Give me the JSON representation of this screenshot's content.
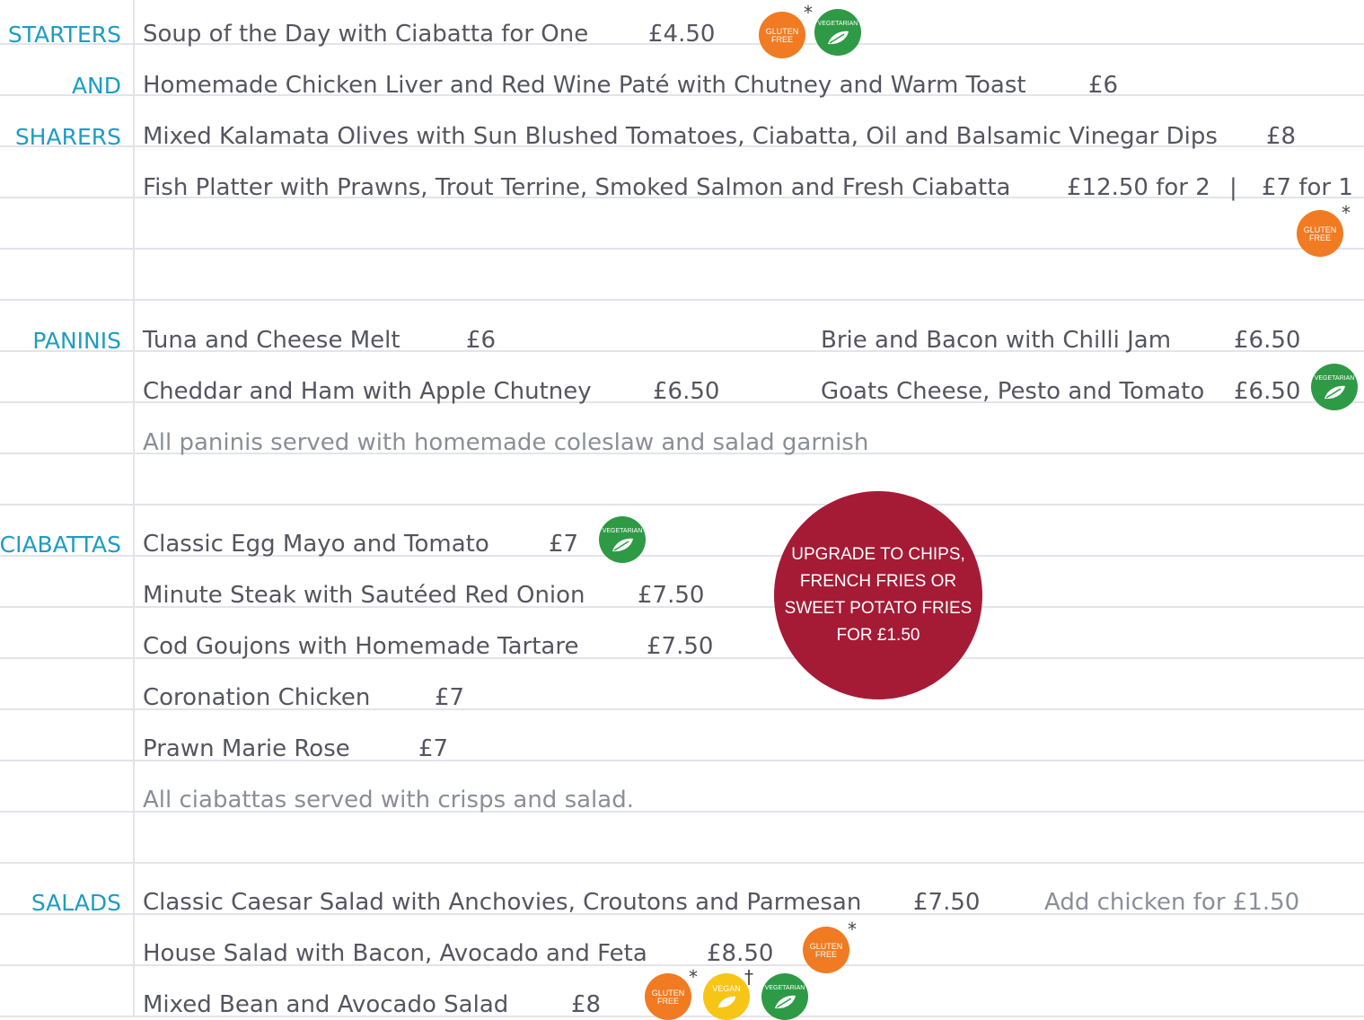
{
  "sections": {
    "starters_1": "STARTERS",
    "starters_2": "AND",
    "starters_3": "SHARERS",
    "paninis": "PANINIS",
    "ciabattas": "CIABATTAS",
    "salads": "SALADS"
  },
  "starters": [
    {
      "name": "Soup of the Day with Ciabatta for One",
      "price": "£4.50"
    },
    {
      "name": "Homemade Chicken Liver and Red Wine Paté with Chutney and Warm Toast",
      "price": "£6"
    },
    {
      "name": "Mixed Kalamata Olives with Sun Blushed Tomatoes, Ciabatta, Oil and Balsamic Vinegar Dips",
      "price": "£8"
    },
    {
      "name": "Fish Platter with Prawns, Trout Terrine, Smoked Salmon and Fresh Ciabatta",
      "price": "£12.50 for 2",
      "separator": "|",
      "price_alt": "£7 for 1"
    }
  ],
  "paninis": [
    {
      "name": "Tuna and Cheese Melt",
      "price": "£6"
    },
    {
      "name": "Cheddar and Ham with Apple Chutney",
      "price": "£6.50"
    },
    {
      "name": "Brie and Bacon with Chilli Jam",
      "price": "£6.50"
    },
    {
      "name": "Goats Cheese, Pesto and Tomato",
      "price": "£6.50"
    }
  ],
  "paninis_note": "All paninis served with homemade coleslaw and salad garnish",
  "ciabattas": [
    {
      "name": "Classic Egg Mayo and Tomato",
      "price": "£7"
    },
    {
      "name": "Minute Steak with Sautéed Red Onion",
      "price": "£7.50"
    },
    {
      "name": "Cod Goujons with Homemade Tartare",
      "price": "£7.50"
    },
    {
      "name": "Coronation Chicken",
      "price": "£7"
    },
    {
      "name": "Prawn Marie Rose",
      "price": "£7"
    }
  ],
  "ciabattas_note": "All ciabattas served with crisps and salad.",
  "promo": "UPGRADE TO CHIPS, FRENCH FRIES OR SWEET POTATO FRIES FOR £1.50",
  "salads": [
    {
      "name": "Classic Caesar Salad with Anchovies, Croutons and Parmesan",
      "price": "£7.50",
      "extra": "Add chicken for £1.50"
    },
    {
      "name": "House Salad with Bacon, Avocado and Feta",
      "price": "£8.50"
    },
    {
      "name": "Mixed Bean and Avocado Salad",
      "price": "£8"
    }
  ],
  "badges": {
    "gluten_free_1": "GLUTEN",
    "gluten_free_2": "FREE",
    "vegetarian": "VEGETARIAN",
    "vegan": "VEGAN",
    "asterisk": "*",
    "dagger": "†"
  },
  "colors": {
    "section": "#1e9cc4",
    "text": "#555560",
    "note": "#8a8e98",
    "gluten_free": "#f07b22",
    "vegetarian": "#2e9a45",
    "vegan": "#f6c516",
    "promo": "#a51b35",
    "rule": "#e3e4ea"
  }
}
